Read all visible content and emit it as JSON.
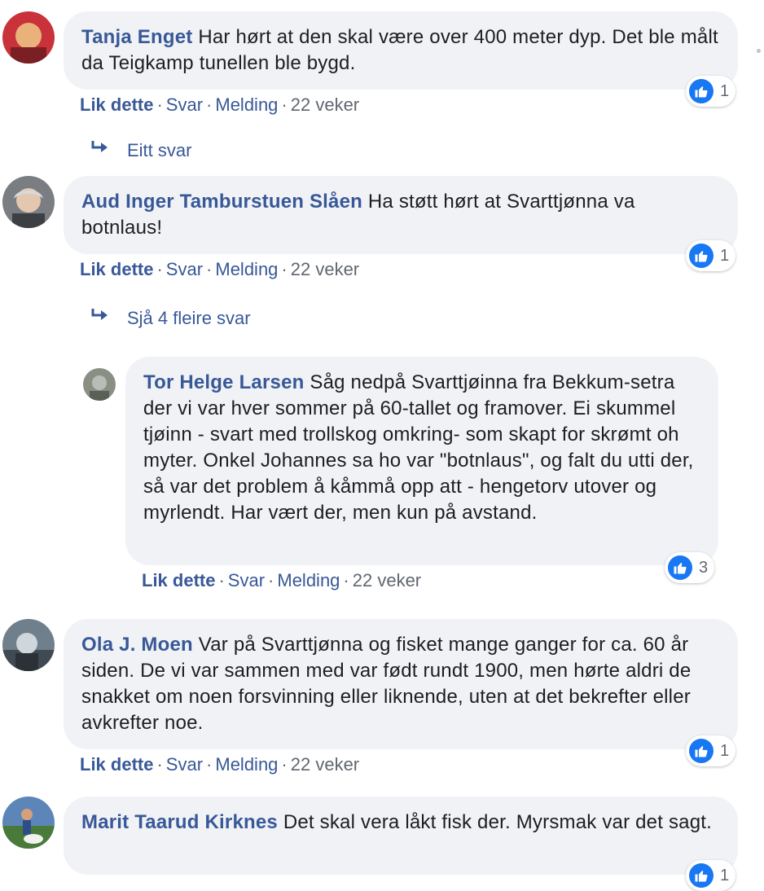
{
  "comments": [
    {
      "author": "Tanja Enget",
      "text": "Har hørt at den skal være over 400 meter dyp. Det ble målt da Teigkamp tunellen ble bygd.",
      "like_label": "Lik dette",
      "reply_label": "Svar",
      "message_label": "Melding",
      "time": "22 veker",
      "reactions": "1",
      "avatar_colors": [
        "#c9323a",
        "#e8b27a"
      ]
    },
    {
      "author": "Aud Inger Tamburstuen Slåen",
      "text": "Ha støtt hørt at Svarttjønna va botnlaus!",
      "like_label": "Lik dette",
      "reply_label": "Svar",
      "message_label": "Melding",
      "time": "22 veker",
      "reactions": "1",
      "avatar_colors": [
        "#7a7d82",
        "#e3c7ae"
      ]
    },
    {
      "author": "Tor Helge Larsen",
      "text": "Såg nedpå Svarttjøinna fra Bekkum-setra der vi var hver sommer på 60-tallet og framover. Ei skummel tjøinn - svart med trollskog omkring- som skapt for skrømt oh myter. Onkel Johannes sa ho var \"botnlaus\", og falt du utti der, så var det problem å kåmmå opp att - hengetorv utover og myrlendt. Har vært der, men kun på avstand.",
      "like_label": "Lik dette",
      "reply_label": "Svar",
      "message_label": "Melding",
      "time": "22 veker",
      "reactions": "3",
      "avatar_colors": [
        "#8a8f84",
        "#b9bdb5"
      ]
    },
    {
      "author": "Ola J. Moen",
      "text": "Var på Svarttjønna og fisket mange ganger for ca. 60 år siden. De vi var sammen med var født rundt 1900, men hørte aldri de snakket om noen forsvinning eller liknende, uten at det bekrefter eller avkrefter noe.",
      "like_label": "Lik dette",
      "reply_label": "Svar",
      "message_label": "Melding",
      "time": "22 veker",
      "reactions": "1",
      "avatar_colors": [
        "#6f7f8c",
        "#cfd6dc"
      ]
    },
    {
      "author": "Marit Taarud Kirknes",
      "text": "Det skal vera låkt fisk der. Myrsmak var det sagt.",
      "reactions": "1",
      "avatar_colors": [
        "#5d86b8",
        "#4a7a3a"
      ]
    }
  ],
  "reply_links": {
    "one_reply": "Eitt svar",
    "more_replies": "Sjå 4 fleire svar"
  },
  "colors": {
    "link": "#385898",
    "bubble": "#f0f2f5",
    "meta": "#606770",
    "like_blue": "#1877f2"
  },
  "icons": [
    "reply-arrow-icon",
    "thumbs-up-icon"
  ]
}
